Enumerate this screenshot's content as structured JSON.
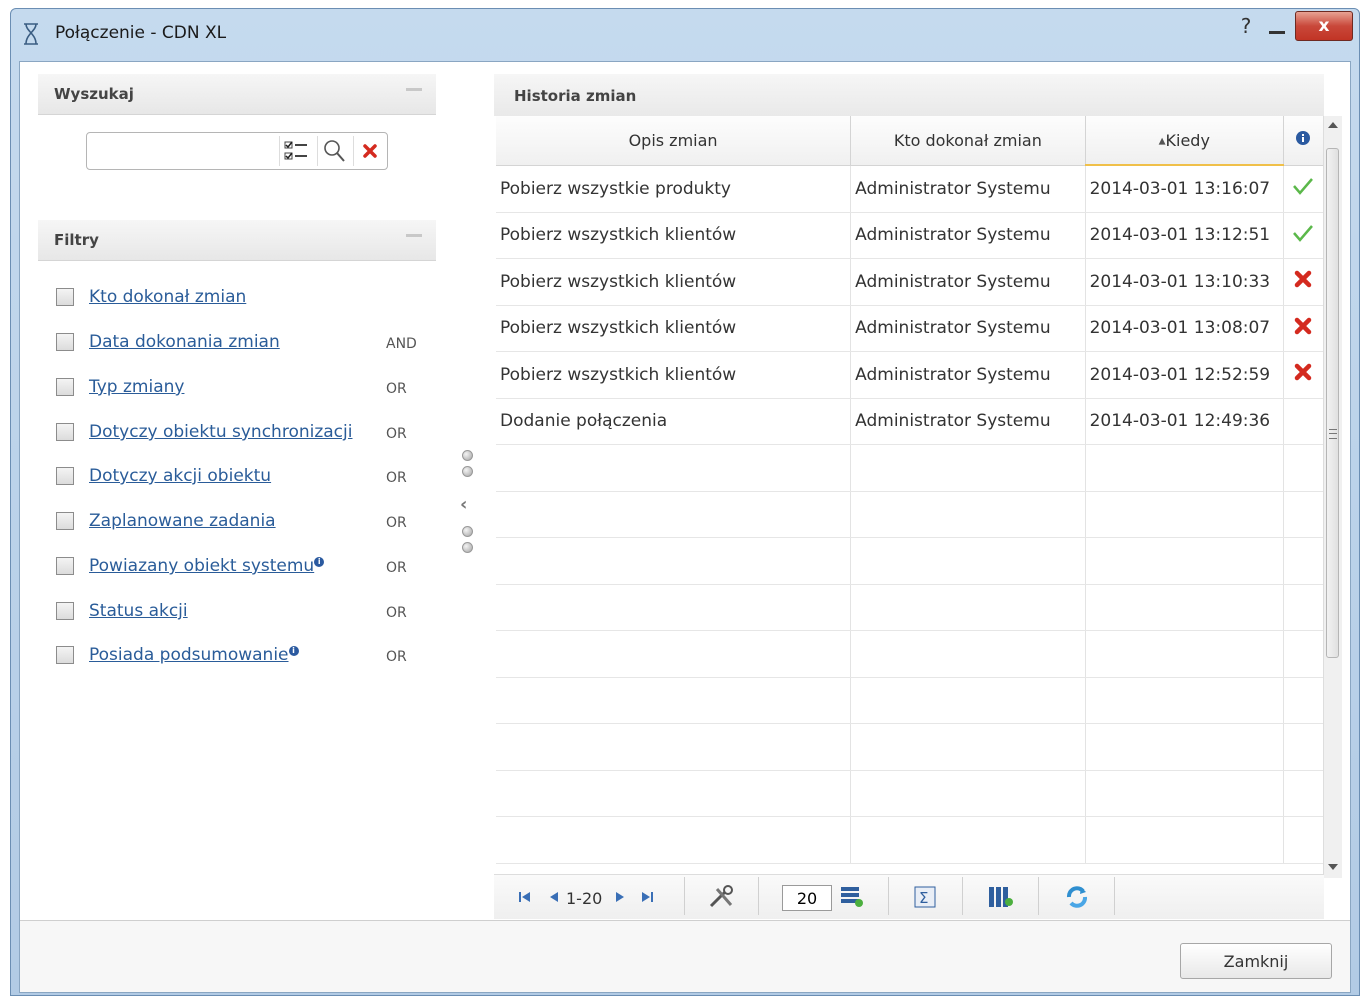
{
  "window": {
    "title": "Połączenie - CDN XL",
    "help": "?",
    "close": "x"
  },
  "search_panel": {
    "title": "Wyszukaj",
    "search_value": "",
    "search_placeholder": ""
  },
  "filters_panel": {
    "title": "Filtry",
    "items": [
      {
        "label": "Kto dokonał zmian",
        "operator": "",
        "info": false
      },
      {
        "label": "Data dokonania zmian",
        "operator": "AND",
        "info": false
      },
      {
        "label": "Typ zmiany",
        "operator": "OR",
        "info": false
      },
      {
        "label": "Dotyczy obiektu synchronizacji",
        "operator": "OR",
        "info": false
      },
      {
        "label": "Dotyczy akcji obiektu",
        "operator": "OR",
        "info": false
      },
      {
        "label": "Zaplanowane zadania",
        "operator": "OR",
        "info": false
      },
      {
        "label": "Powiazany obiekt systemu",
        "operator": "OR",
        "info": true
      },
      {
        "label": "Status akcji",
        "operator": "OR",
        "info": false
      },
      {
        "label": "Posiada podsumowanie",
        "operator": "OR",
        "info": true
      }
    ]
  },
  "grid": {
    "title": "Historia zmian",
    "columns": [
      "Opis zmian",
      "Kto dokonał zmian",
      "Kiedy"
    ],
    "sort_indicator": "▲",
    "rows": [
      {
        "desc": "Pobierz wszystkie produkty",
        "who": "Administrator Systemu",
        "when": "2014-03-01 13:16:07",
        "status": "ok"
      },
      {
        "desc": "Pobierz wszystkich klientów",
        "who": "Administrator Systemu",
        "when": "2014-03-01 13:12:51",
        "status": "ok"
      },
      {
        "desc": "Pobierz wszystkich klientów",
        "who": "Administrator Systemu",
        "when": "2014-03-01 13:10:33",
        "status": "error"
      },
      {
        "desc": "Pobierz wszystkich klientów",
        "who": "Administrator Systemu",
        "when": "2014-03-01 13:08:07",
        "status": "error"
      },
      {
        "desc": "Pobierz wszystkich klientów",
        "who": "Administrator Systemu",
        "when": "2014-03-01 12:52:59",
        "status": "error"
      },
      {
        "desc": "Dodanie połączenia",
        "who": "Administrator Systemu",
        "when": "2014-03-01 12:49:36",
        "status": "none"
      }
    ],
    "empty_rows": 9
  },
  "pager": {
    "range": "1-20",
    "page_size": "20"
  },
  "footer": {
    "close_label": "Zamknij"
  },
  "colors": {
    "link": "#2a5c99",
    "ok": "#5bb84a",
    "error": "#d42a1f",
    "info": "#2b5aa0",
    "sort_accent": "#f0c049"
  }
}
